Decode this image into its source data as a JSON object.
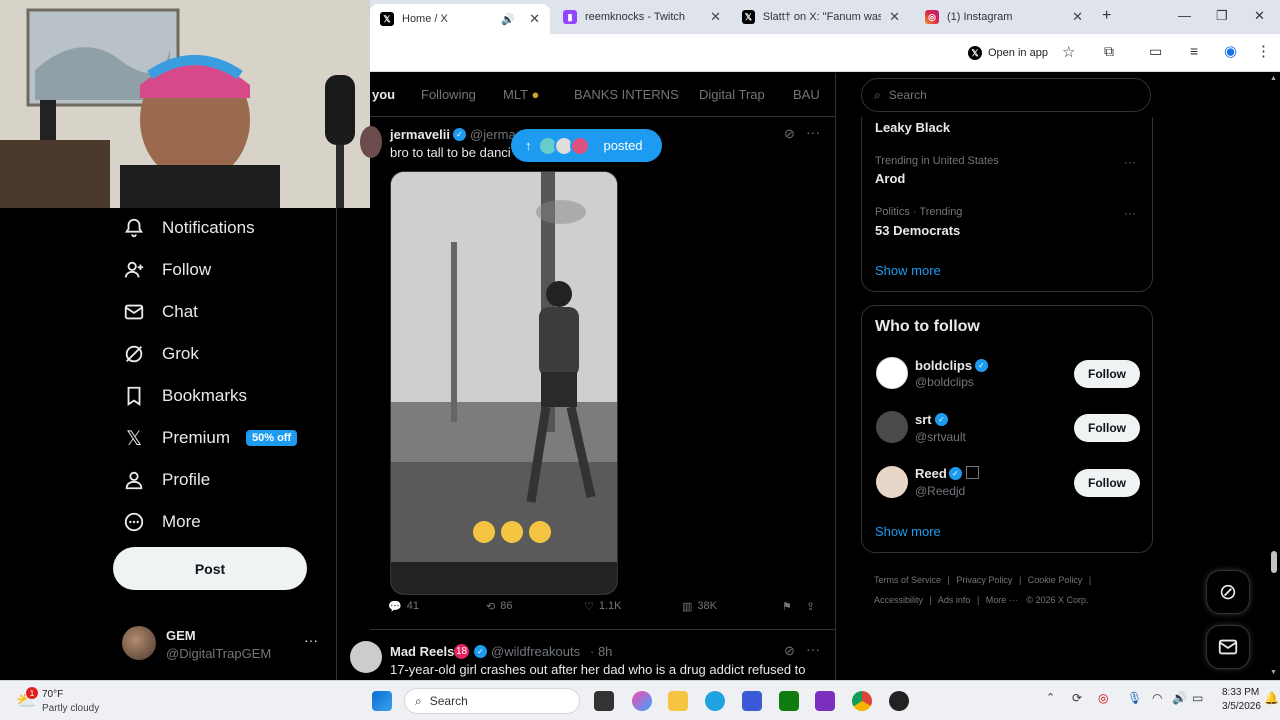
{
  "browser": {
    "tabs": [
      {
        "title": "Home / X",
        "icon": "x-icon"
      },
      {
        "title": "reemknocks - Twitch",
        "icon": "twitch-icon"
      },
      {
        "title": "Slatt† on X: \"Fanum was be",
        "icon": "x-icon"
      },
      {
        "title": "(1) Instagram",
        "icon": "instagram-icon"
      }
    ],
    "open_in_app": "Open in app"
  },
  "nav": {
    "items": [
      {
        "label": "Notifications",
        "icon": "bell-icon"
      },
      {
        "label": "Follow",
        "icon": "follow-icon"
      },
      {
        "label": "Chat",
        "icon": "mail-icon"
      },
      {
        "label": "Grok",
        "icon": "grok-icon"
      },
      {
        "label": "Bookmarks",
        "icon": "bookmark-icon"
      },
      {
        "label": "Premium",
        "icon": "x-icon"
      },
      {
        "label": "Profile",
        "icon": "person-icon"
      },
      {
        "label": "More",
        "icon": "more-circle-icon"
      }
    ],
    "premium_badge": "50% off",
    "post_label": "Post",
    "account": {
      "name": "GEM",
      "handle": "@DigitalTrapGEM"
    }
  },
  "feed": {
    "tabs": [
      "you",
      "Following",
      "MLT",
      "BANKS INTERNS",
      "Digital Trap",
      "BAU"
    ],
    "posted_pill": "posted",
    "post1": {
      "author": "jermavelii",
      "handle": "@jerma",
      "text": "bro to tall to be danci",
      "stats": {
        "replies": "41",
        "reposts": "86",
        "likes": "1.1K",
        "views": "38K"
      }
    },
    "post2": {
      "author": "Mad Reels",
      "badge": "18",
      "handle": "@wildfreakouts",
      "time": "· 8h",
      "text": "17-year-old girl crashes out after her dad who is a drug addict refused to"
    }
  },
  "sidebar": {
    "search_placeholder": "Search",
    "trending": [
      {
        "meta": "",
        "title": "Leaky Black"
      },
      {
        "meta": "Trending in United States",
        "title": "Arod"
      },
      {
        "meta": "Politics · Trending",
        "title": "53 Democrats"
      }
    ],
    "show_more": "Show more",
    "who_to_follow_title": "Who to follow",
    "follow_label": "Follow",
    "suggestions": [
      {
        "name": "boldclips",
        "handle": "@boldclips"
      },
      {
        "name": "srt",
        "handle": "@srtvault"
      },
      {
        "name": "Reed",
        "handle": "@Reedjd"
      }
    ],
    "footer": [
      "Terms of Service",
      "|",
      "Privacy Policy",
      "|",
      "Cookie Policy",
      "|",
      "Accessibility",
      "|",
      "Ads info",
      "|",
      "More ···",
      "© 2026 X Corp."
    ]
  },
  "taskbar": {
    "weather_temp": "70°F",
    "weather_desc": "Partly cloudy",
    "weather_badge": "1",
    "search_label": "Search",
    "time": "8:33 PM",
    "date": "3/5/2026"
  },
  "colors": {
    "accent": "#1d9bf0",
    "background": "#000000",
    "text": "#e7e9ea",
    "muted": "#71767b"
  }
}
